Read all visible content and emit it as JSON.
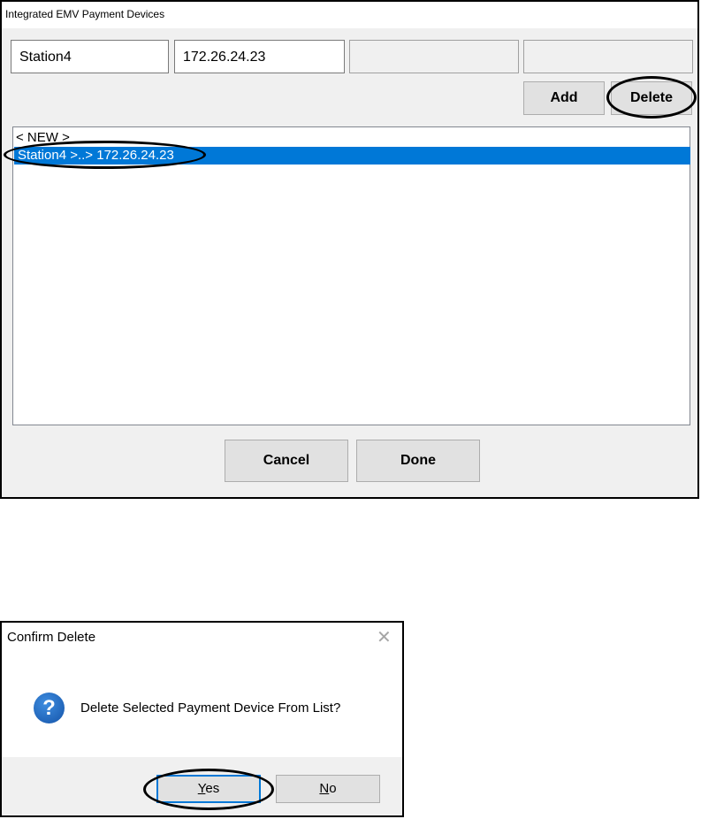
{
  "devices_window": {
    "title": "Integrated EMV Payment Devices",
    "station_field": "Station4",
    "ip_field": "172.26.24.23",
    "extra_field_1": "",
    "extra_field_2": "",
    "add_label": "Add",
    "delete_label": "Delete",
    "list_items": [
      "< NEW >",
      "Station4 >..> 172.26.24.23"
    ],
    "selected_item_index": 1,
    "cancel_label": "Cancel",
    "done_label": "Done"
  },
  "confirm_dialog": {
    "title": "Confirm Delete",
    "message": "Delete Selected Payment Device From List?",
    "icon": "question-icon",
    "close_icon": "close-icon",
    "yes_label": "Yes",
    "no_label": "No",
    "yes_mnemonic": "Y",
    "no_mnemonic": "N"
  },
  "colors": {
    "selection": "#0078d7",
    "dialog_background": "#f0f0f0",
    "annotation_oval": "#000000"
  }
}
